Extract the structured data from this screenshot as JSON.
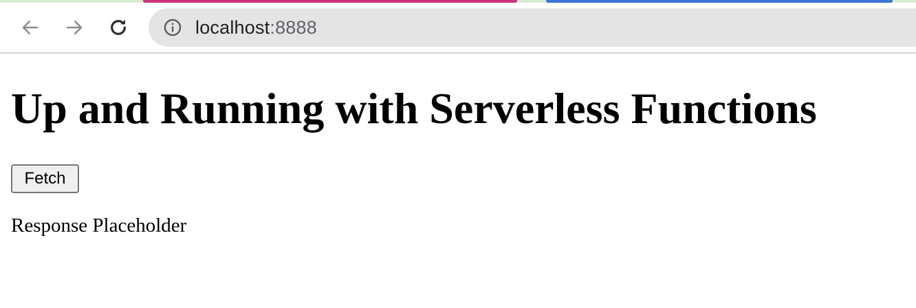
{
  "browser": {
    "tab_colors": {
      "strip": "#d8ecd2",
      "active_tab_accent": "#c8357d",
      "other_tab_accent": "#3a74d8"
    },
    "icons": {
      "back": "arrow-left-icon",
      "forward": "arrow-right-icon",
      "reload": "reload-icon",
      "site_info": "info-circle-icon"
    },
    "address_bar": {
      "host": "localhost",
      "port": ":8888"
    }
  },
  "page": {
    "heading": "Up and Running with Serverless Functions",
    "fetch_button_label": "Fetch",
    "response_text": "Response Placeholder"
  }
}
